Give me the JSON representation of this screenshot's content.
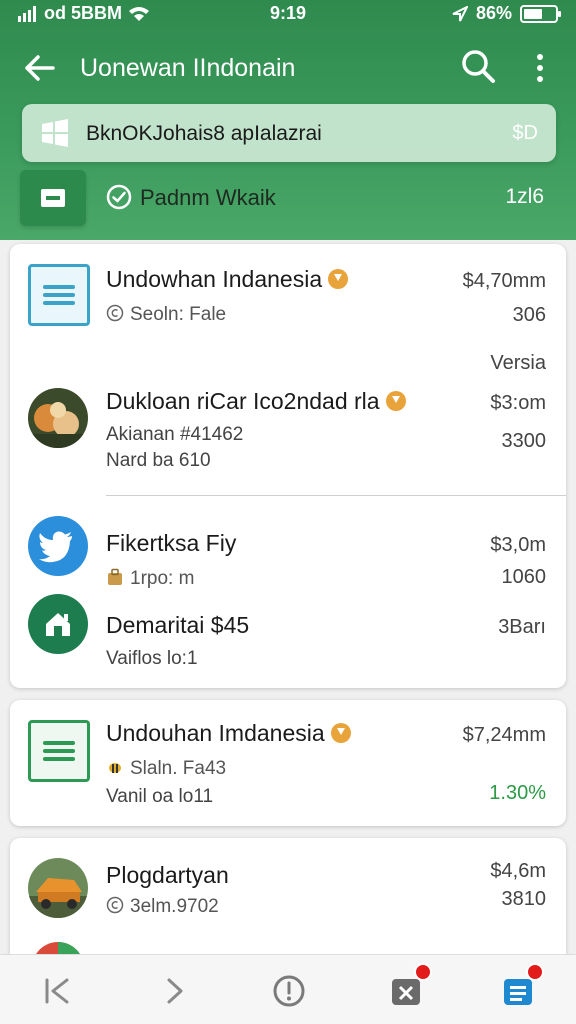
{
  "status_bar": {
    "carrier": "od 5BBM",
    "time": "9:19",
    "battery": "86%"
  },
  "app_bar": {
    "title": "Uonewan IIndonain"
  },
  "banner": {
    "text": "BknOKJohais8 apIalazrai",
    "right": "$D"
  },
  "subbar": {
    "label": "Padnm Wkaik",
    "right": "1zl6"
  },
  "card1": {
    "items": [
      {
        "title": "Undowhan Indanesia",
        "subtitle": "Seoln: Fale",
        "price": "$4,70mm",
        "num": "306"
      },
      {
        "version_label": "Versia",
        "title": "Dukloan riCar Ico2ndad rla",
        "subtitle": "Akianan #41462",
        "subtitle2": "Nard ba 610",
        "price": "$3:om",
        "num": "3300"
      },
      {
        "title": "Fikertksa Fiy",
        "subtitle": "1rpo: m",
        "price": "$3,0m",
        "num": "1060"
      },
      {
        "title": "Demaritai $45",
        "subtitle": "Vaiflos lo:1",
        "price": "3Barı"
      }
    ]
  },
  "card2": {
    "title": "Undouhan Imdanesia",
    "subtitle": "Slaln. Fa43",
    "subtitle2": "Vanil oa lo11",
    "price": "$7,24mm",
    "change": "1.30%"
  },
  "card3": {
    "title": "Plogdartyan",
    "subtitle": "3elm.9702",
    "price": "$4,6m",
    "num": "3810"
  },
  "colors": {
    "brand_green": "#2f8a4e",
    "accent_orange": "#e8a33a",
    "positive": "#2c9a45",
    "notification": "#e21b1b"
  },
  "bottom_nav": [
    "back-icon",
    "forward-icon",
    "info-icon",
    "apps-icon",
    "menu-list-icon"
  ]
}
